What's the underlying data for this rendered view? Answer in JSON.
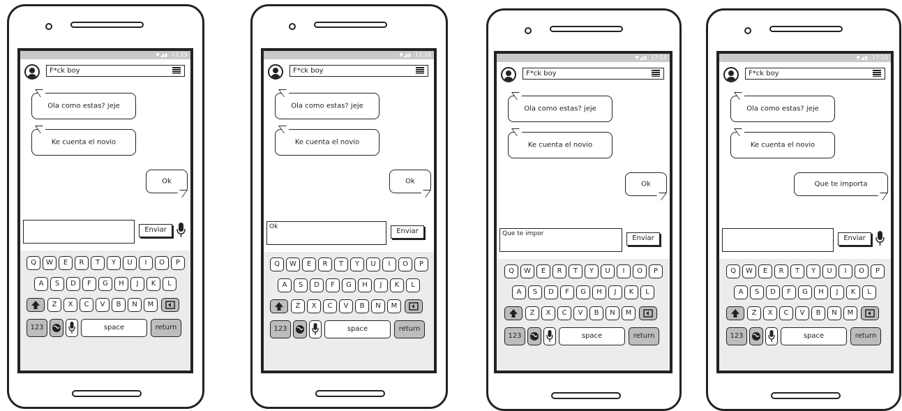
{
  "status": {
    "time": "17:15",
    "icons": "▼◢▮"
  },
  "icons": [
    "avatar-icon",
    "menu-icon",
    "mic-icon",
    "shift-icon",
    "globe-icon",
    "backspace-icon"
  ],
  "phones": [
    {
      "contact": "F*ck boy",
      "messages": [
        {
          "side": "left",
          "text": "Ola como estas? jeje"
        },
        {
          "side": "left",
          "text": "Ke cuenta el novio"
        },
        {
          "side": "right",
          "text": "Ok"
        }
      ],
      "input_value": "",
      "send_label": "Enviar",
      "show_mic": true
    },
    {
      "contact": "F*ck boy",
      "messages": [
        {
          "side": "left",
          "text": "Ola como estas? jeje"
        },
        {
          "side": "left",
          "text": "Ke cuenta el novio"
        },
        {
          "side": "right",
          "text": "Ok"
        }
      ],
      "input_value": "Ok",
      "send_label": "Enviar",
      "show_mic": false
    },
    {
      "contact": "F*ck boy",
      "messages": [
        {
          "side": "left",
          "text": "Ola como estas? jeje"
        },
        {
          "side": "left",
          "text": "Ke cuenta el novio"
        },
        {
          "side": "right",
          "text": "Ok"
        }
      ],
      "input_value": "Que te impor",
      "send_label": "Enviar",
      "show_mic": false
    },
    {
      "contact": "F*ck boy",
      "messages": [
        {
          "side": "left",
          "text": "Ola como estas? jeje"
        },
        {
          "side": "left",
          "text": "Ke cuenta el novio"
        },
        {
          "side": "right",
          "text": "Que te importa"
        }
      ],
      "input_value": "",
      "send_label": "Enviar",
      "show_mic": true
    }
  ],
  "keyboard": {
    "row1": [
      "Q",
      "W",
      "E",
      "R",
      "T",
      "Y",
      "U",
      "I",
      "O",
      "P"
    ],
    "row2": [
      "A",
      "S",
      "D",
      "F",
      "G",
      "H",
      "J",
      "K",
      "L"
    ],
    "row3": [
      "Z",
      "X",
      "C",
      "V",
      "B",
      "N",
      "M"
    ],
    "numbers_label": "123",
    "space_label": "space",
    "return_label": "return"
  }
}
